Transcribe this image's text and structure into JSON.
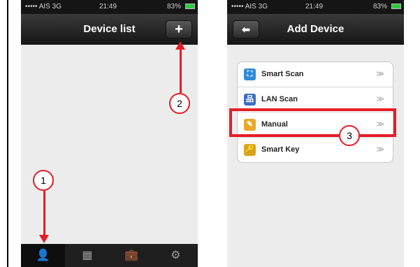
{
  "left_screen": {
    "status": {
      "carrier": "••••• AIS  3G",
      "time": "21:49",
      "battery": "83%"
    },
    "title": "Device list",
    "add_button": "+",
    "tabs": [
      {
        "icon": "person-icon",
        "glyph": "👤"
      },
      {
        "icon": "grid-icon",
        "glyph": "▦"
      },
      {
        "icon": "briefcase-icon",
        "glyph": "💼"
      },
      {
        "icon": "gear-icon",
        "glyph": "⚙"
      }
    ],
    "annotations": [
      "1",
      "2"
    ]
  },
  "right_screen": {
    "status": {
      "carrier": "••••• AIS  3G",
      "time": "21:49",
      "battery": "83%"
    },
    "title": "Add Device",
    "back_button": "⬅",
    "menu": [
      {
        "label": "Smart Scan",
        "icon": "scan-icon",
        "glyph": "⛶",
        "color": "#2e8bd8",
        "chevron": "≫"
      },
      {
        "label": "LAN Scan",
        "icon": "network-icon",
        "glyph": "品",
        "color": "#3c6fc4",
        "chevron": "≫"
      },
      {
        "label": "Manual",
        "icon": "pencil-icon",
        "glyph": "✎",
        "color": "#e8a82a",
        "chevron": "≫"
      },
      {
        "label": "Smart Key",
        "icon": "key-icon",
        "glyph": "🔑",
        "color": "#d9a520",
        "chevron": "≫"
      }
    ],
    "annotation": "3"
  },
  "colors": {
    "annotation": "#e41e26",
    "active_tab": "#2aa7e8"
  }
}
